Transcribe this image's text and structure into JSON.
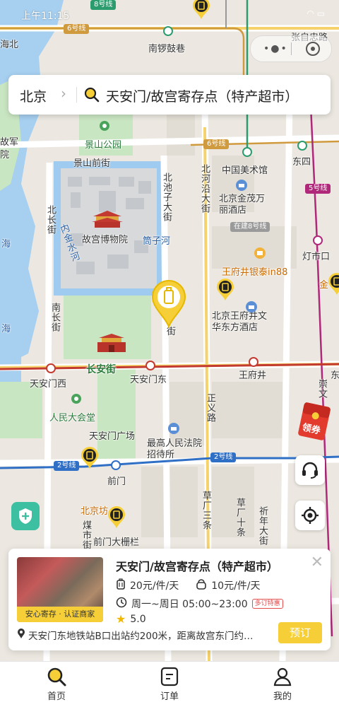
{
  "status_bar": {
    "time": "上午11:15"
  },
  "search": {
    "city": "北京",
    "query": "天安门/故宫寄存点（特产超市）"
  },
  "map": {
    "labels": {
      "haibei": "海北",
      "nanluoguxiang": "南锣鼓巷",
      "zhangzizhonglu": "张自忠路",
      "jingshan": "景山公园",
      "jingshan_front": "景山前街",
      "gugong": "故宫博物院",
      "tongzihe": "筒子河",
      "neijinshui": "内金水河",
      "beichizi": "北池子大街",
      "beiheyan": "北河沿大街",
      "meishuguan": "中国美术馆",
      "dongsi": "东四",
      "jinmao": "北京金茂万丽酒店",
      "zaijian8": "在建8号线",
      "dengshikou": "灯市口",
      "wangfujing_yintai": "王府井银泰in88",
      "wenhua": "北京王府井文华东方酒店",
      "wangfujing": "王府井",
      "changan": "长安街",
      "tiananmen_west": "天安门西",
      "tiananmen_east": "天安门东",
      "renmin": "人民大会堂",
      "guangchang": "天安门广场",
      "zhengyi": "正义路",
      "court": "最高人民法院招待所",
      "qianmen": "前门",
      "qianmen_dashilan": "前门大栅栏",
      "beijing_station": "北京坊",
      "meishijie": "煤市街",
      "caochang3": "草厂三条",
      "caochang10": "草厂十条",
      "qiannian": "祈年大街",
      "nanchang": "南长街",
      "beichang": "北长街",
      "jiao": "街",
      "jin": "金",
      "gu_jun": "故军",
      "yuan": "院",
      "hai1": "海",
      "hai2": "海",
      "chongwen": "崇文",
      "dong": "东"
    },
    "line_badges": {
      "line6_top": "6号线",
      "line6_mid": "6号线",
      "line8_top": "8号线",
      "line5": "5号线",
      "line2_left": "2号线",
      "line2_right": "2号线"
    }
  },
  "coupon": {
    "label": "领券"
  },
  "card": {
    "name": "天安门/故宫寄存点（特产超市）",
    "tag": "安心寄存 · 认证商家",
    "price_luggage": "20元/件/天",
    "price_bag": "10元/件/天",
    "hours": "周一~周日 05:00~23:00",
    "promo": "多订特惠",
    "rating": "5.0",
    "address": "天安门东地铁站B口出站约200米，距离故宫东门约…",
    "book_label": "预订"
  },
  "tabs": [
    {
      "label": "首页",
      "icon": "search-icon",
      "active": true
    },
    {
      "label": "订单",
      "icon": "order-icon",
      "active": false
    },
    {
      "label": "我的",
      "icon": "person-icon",
      "active": false
    }
  ],
  "colors": {
    "accent": "#f6cf38",
    "metro_red": "#c23a30",
    "metro_blue": "#2f6fc5",
    "park": "#c9e6c2",
    "water": "#9ecbef"
  }
}
